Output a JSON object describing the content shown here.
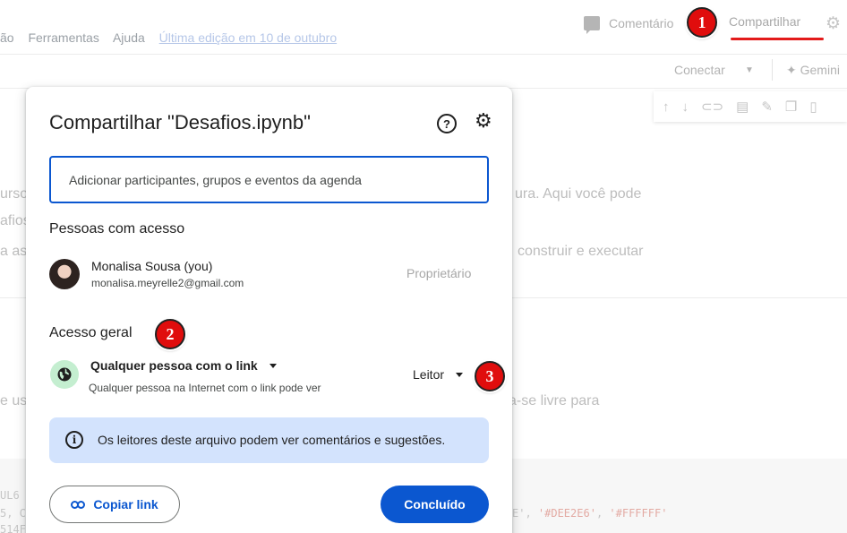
{
  "background": {
    "menu": [
      "ão",
      "Ferramentas",
      "Ajuda"
    ],
    "last_edit": "Última edição em 10 de outubro",
    "comment_label": "Comentário",
    "share_tab": "Compartilhar",
    "connect_label": "Conectar",
    "gemini_label": "✦ Gemini",
    "text_fragments": [
      "urso",
      "afios",
      "a as",
      "ura. Aqui você pode",
      "construir e executar",
      "e us",
      "a-se livre para"
    ],
    "code_fragments": [
      "UL6",
      "5, C",
      "514F",
      "'#DEE2E6'",
      "'#FFFFFF'"
    ]
  },
  "dialog": {
    "title": "Compartilhar \"Desafios.ipynb\"",
    "help_glyph": "?",
    "settings_glyph": "⚙",
    "invite_placeholder": "Adicionar participantes, grupos e eventos da agenda",
    "people_heading": "Pessoas com acesso",
    "person": {
      "name": "Monalisa Sousa (you)",
      "email": "monalisa.meyrelle2@gmail.com",
      "role": "Proprietário"
    },
    "general_heading": "Acesso geral",
    "access_option": "Qualquer pessoa com o link",
    "access_description": "Qualquer pessoa na Internet com o link pode ver",
    "role_option": "Leitor",
    "info_text": "Os leitores deste arquivo podem ver comentários e sugestões.",
    "copy_link_label": "Copiar link",
    "done_label": "Concluído"
  },
  "annotations": [
    "1",
    "2",
    "3"
  ],
  "colors": {
    "primary": "#0b57d0",
    "info_bg": "#d3e3fd",
    "badge_red": "#e00d0d",
    "underline_red": "#e31b1b",
    "globe_bg": "#c4eed0"
  }
}
